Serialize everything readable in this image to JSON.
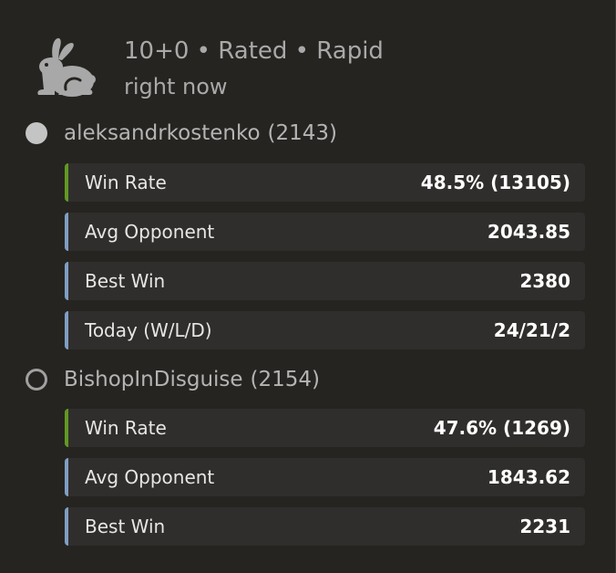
{
  "game": {
    "setup": "10+0 • Rated • Rapid",
    "time": "right now",
    "speed_icon": "rabbit-icon"
  },
  "players": [
    {
      "side": "white",
      "name": "aleksandrkostenko",
      "rating": "(2143)",
      "stats": [
        {
          "label": "Win Rate",
          "value": "48.5% (13105)"
        },
        {
          "label": "Avg Opponent",
          "value": "2043.85"
        },
        {
          "label": "Best Win",
          "value": "2380"
        },
        {
          "label": "Today (W/L/D)",
          "value": "24/21/2"
        }
      ]
    },
    {
      "side": "black",
      "name": "BishopInDisguise",
      "rating": "(2154)",
      "stats": [
        {
          "label": "Win Rate",
          "value": "47.6% (1269)"
        },
        {
          "label": "Avg Opponent",
          "value": "1843.62"
        },
        {
          "label": "Best Win",
          "value": "2231"
        }
      ]
    }
  ],
  "colors": {
    "background": "#262421",
    "row_background": "#302e2c",
    "win_rate_accent": "#629924",
    "stat_accent": "#7f9fc4"
  }
}
